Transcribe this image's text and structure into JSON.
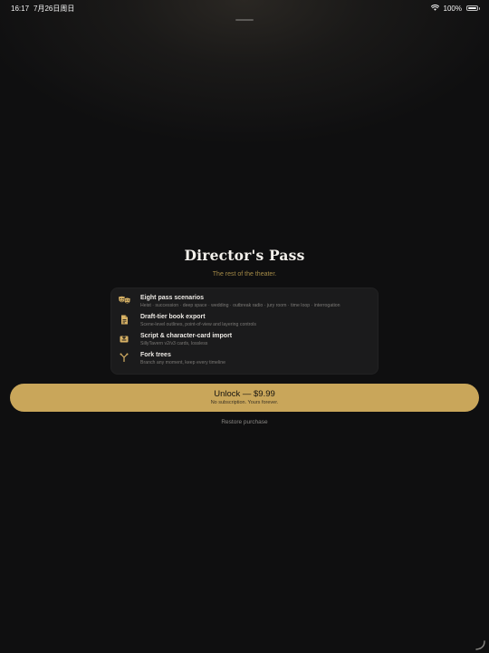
{
  "status_bar": {
    "time": "16:17",
    "date": "7月26日周日",
    "battery": "100%"
  },
  "paywall": {
    "title": "Director's Pass",
    "subtitle": "The rest of the theater.",
    "features": [
      {
        "icon": "theater-masks-icon",
        "title": "Eight pass scenarios",
        "description": "Heist · succession · deep space · wedding · outbreak radio · jury room · time loop · interrogation"
      },
      {
        "icon": "document-icon",
        "title": "Draft-tier book export",
        "description": "Scene-level outlines, point-of-view and layering controls"
      },
      {
        "icon": "inbox-import-icon",
        "title": "Script & character-card import",
        "description": "SillyTavern v2/v3 cards, lossless"
      },
      {
        "icon": "fork-branch-icon",
        "title": "Fork trees",
        "description": "Branch any moment, keep every timeline"
      }
    ],
    "unlock_label": "Unlock — $9.99",
    "unlock_sub": "No subscription. Yours forever.",
    "restore_label": "Restore purchase"
  },
  "colors": {
    "accent": "#c9a65a",
    "icon_gold": "#d8b265",
    "subtitle_gold": "#a48a47",
    "background": "#0f0f10",
    "card": "#1b1b1c"
  }
}
